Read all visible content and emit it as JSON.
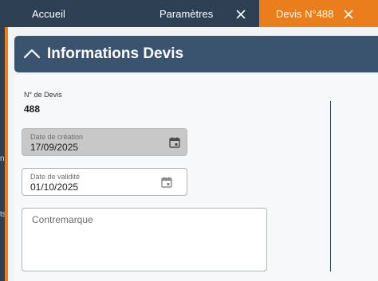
{
  "tabs": {
    "home": {
      "label": "Accueil"
    },
    "params": {
      "label": "Paramètres",
      "close_icon": "close-icon"
    },
    "active": {
      "label": "Devis N°488",
      "close_icon": "close-icon"
    }
  },
  "sidebar": {
    "glyph_1": "n",
    "glyph_2": "ts"
  },
  "section": {
    "title": "Informations Devis",
    "toggle_icon": "chevron-up-icon"
  },
  "form": {
    "quote_number": {
      "label": "N° de Devis",
      "value": "488"
    },
    "creation_date": {
      "label": "Date de création",
      "value": "17/09/2025",
      "icon": "calendar-icon",
      "disabled": true
    },
    "validity_date": {
      "label": "Date de validité",
      "value": "01/10/2025",
      "icon": "calendar-icon"
    },
    "counter_mark": {
      "placeholder": "Contremarque",
      "value": ""
    }
  },
  "colors": {
    "tabbar": "#2e4053",
    "active_tab": "#ea7e1c",
    "section_header": "#3a5470",
    "background": "#f1f3f5"
  }
}
